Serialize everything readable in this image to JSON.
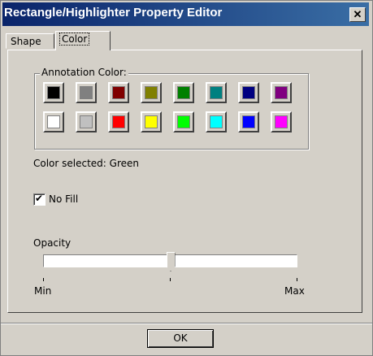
{
  "window": {
    "title": "Rectangle/Highlighter Property Editor",
    "close_label": "✕"
  },
  "tabs": [
    {
      "label": "Shape"
    },
    {
      "label": "Color",
      "selected": true
    }
  ],
  "annotation_color": {
    "group_label": "Annotation Color:",
    "swatches": [
      {
        "name": "Black",
        "color": "#000000"
      },
      {
        "name": "Gray",
        "color": "#808080"
      },
      {
        "name": "Maroon",
        "color": "#800000"
      },
      {
        "name": "Olive",
        "color": "#808000"
      },
      {
        "name": "Green",
        "color": "#008000"
      },
      {
        "name": "Teal",
        "color": "#008080"
      },
      {
        "name": "Navy",
        "color": "#000080"
      },
      {
        "name": "Purple",
        "color": "#800080"
      },
      {
        "name": "White",
        "color": "#ffffff"
      },
      {
        "name": "Silver",
        "color": "#c0c0c0"
      },
      {
        "name": "Red",
        "color": "#ff0000"
      },
      {
        "name": "Yellow",
        "color": "#ffff00"
      },
      {
        "name": "Lime",
        "color": "#00ff00"
      },
      {
        "name": "Aqua",
        "color": "#00ffff"
      },
      {
        "name": "Blue",
        "color": "#0000ff"
      },
      {
        "name": "Fuchsia",
        "color": "#ff00ff"
      }
    ],
    "selected_text": "Color selected: Green"
  },
  "no_fill": {
    "label": "No Fill",
    "checked": true
  },
  "opacity": {
    "label": "Opacity",
    "min_label": "Min",
    "max_label": "Max",
    "value_fraction": 0.5
  },
  "buttons": {
    "ok_label": "OK"
  }
}
